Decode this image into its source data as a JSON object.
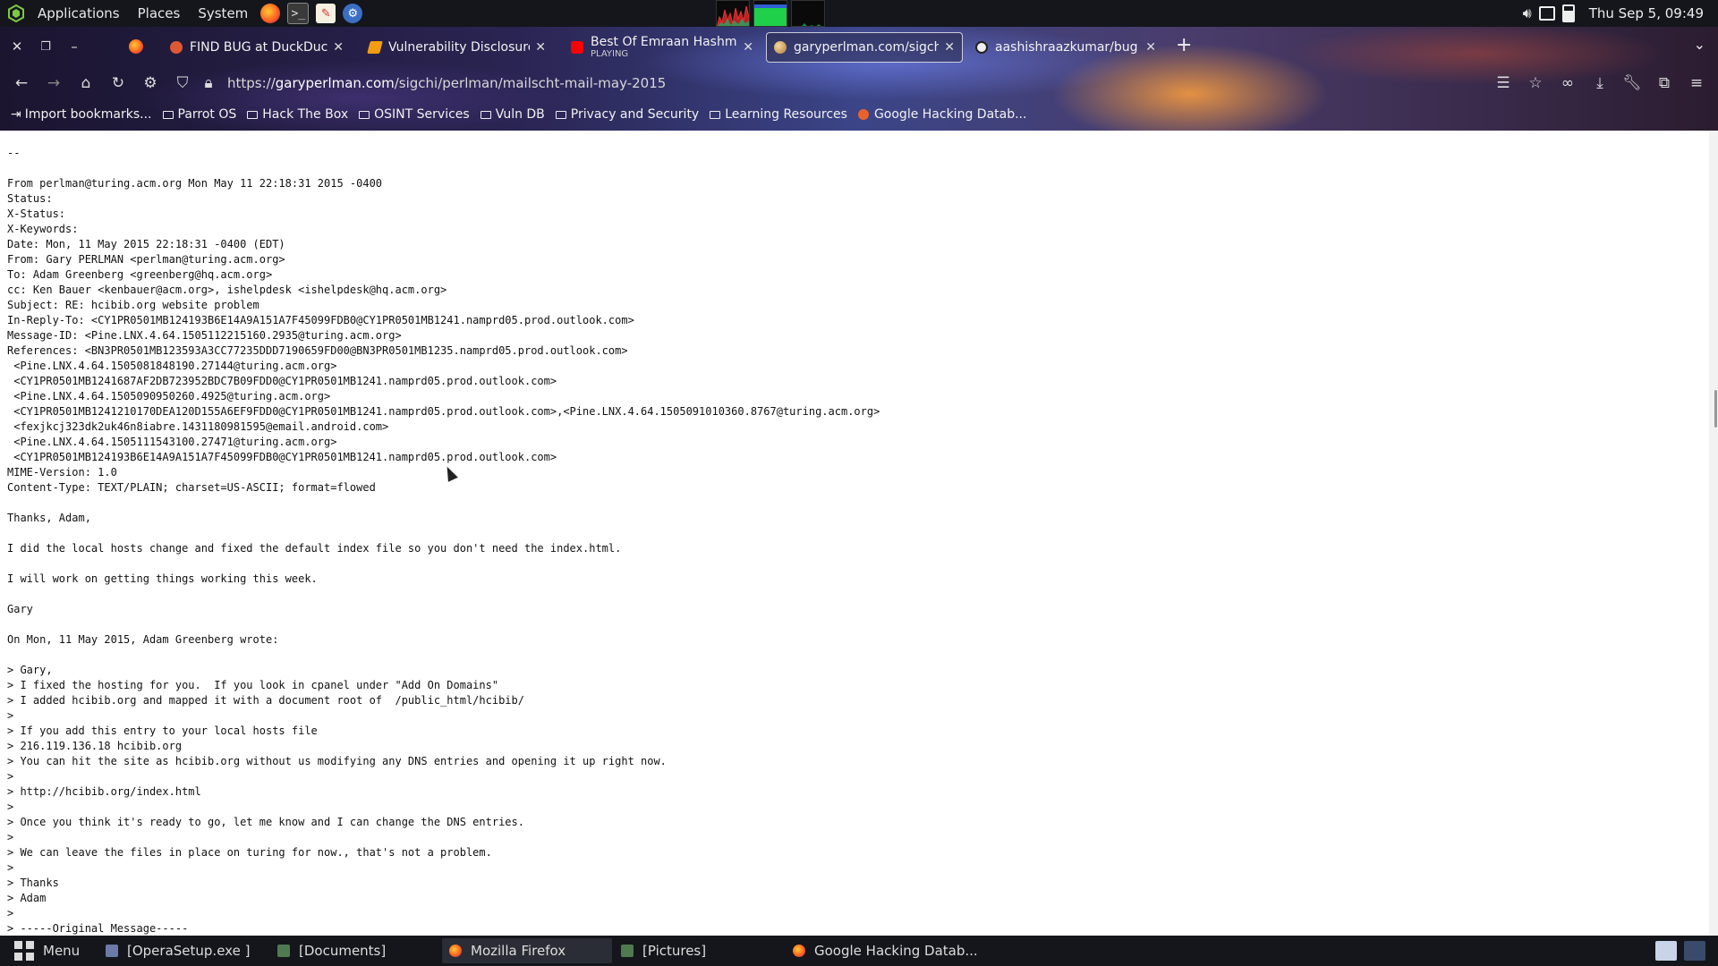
{
  "system_panel": {
    "menus": [
      "Applications",
      "Places",
      "System"
    ],
    "clock": "Thu Sep  5, 09:49"
  },
  "browser": {
    "tabs": [
      {
        "title": "FIND BUG at DuckDuckGo",
        "active": false
      },
      {
        "title": "Vulnerability Disclosure P",
        "active": false
      },
      {
        "title": "Best Of Emraan Hashmi",
        "subtitle": "PLAYING",
        "active": false
      },
      {
        "title": "garyperlman.com/sigchi/",
        "active": true
      },
      {
        "title": "aashishraazkumar/bug",
        "active": false
      }
    ],
    "new_tab_label": "+",
    "url_prefix": "https://",
    "url_host": "garyperlman.com",
    "url_path": "/sigchi/perlman/mailscht-mail-may-2015",
    "bookmarks": [
      "Import bookmarks...",
      "Parrot OS",
      "Hack The Box",
      "OSINT Services",
      "Vuln DB",
      "Privacy and Security",
      "Learning Resources",
      "Google Hacking Datab..."
    ]
  },
  "mail_lines": [
    "",
    "--",
    "",
    "From perlman@turing.acm.org Mon May 11 22:18:31 2015 -0400",
    "Status:",
    "X-Status:",
    "X-Keywords:",
    "Date: Mon, 11 May 2015 22:18:31 -0400 (EDT)",
    "From: Gary PERLMAN <perlman@turing.acm.org>",
    "To: Adam Greenberg <greenberg@hq.acm.org>",
    "cc: Ken Bauer <kenbauer@acm.org>, ishelpdesk <ishelpdesk@hq.acm.org>",
    "Subject: RE: hcibib.org website problem",
    "In-Reply-To: <CY1PR0501MB124193B6E14A9A151A7F45099FDB0@CY1PR0501MB1241.namprd05.prod.outlook.com>",
    "Message-ID: <Pine.LNX.4.64.1505112215160.2935@turing.acm.org>",
    "References: <BN3PR0501MB123593A3CC77235DDD7190659FD00@BN3PR0501MB1235.namprd05.prod.outlook.com>",
    " <Pine.LNX.4.64.1505081848190.27144@turing.acm.org>",
    " <CY1PR0501MB1241687AF2DB723952BDC7B09FDD0@CY1PR0501MB1241.namprd05.prod.outlook.com>",
    " <Pine.LNX.4.64.1505090950260.4925@turing.acm.org>",
    " <CY1PR0501MB1241210170DEA120D155A6EF9FDD0@CY1PR0501MB1241.namprd05.prod.outlook.com>,<Pine.LNX.4.64.1505091010360.8767@turing.acm.org>",
    " <fexjkcj323dk2uk46n8iabre.1431180981595@email.android.com>",
    " <Pine.LNX.4.64.1505111543100.27471@turing.acm.org>",
    " <CY1PR0501MB124193B6E14A9A151A7F45099FDB0@CY1PR0501MB1241.namprd05.prod.outlook.com>",
    "MIME-Version: 1.0",
    "Content-Type: TEXT/PLAIN; charset=US-ASCII; format=flowed",
    "",
    "Thanks, Adam,",
    "",
    "I did the local hosts change and fixed the default index file so you don't need the index.html.",
    "",
    "I will work on getting things working this week.",
    "",
    "Gary",
    "",
    "On Mon, 11 May 2015, Adam Greenberg wrote:",
    "",
    "> Gary,",
    "> I fixed the hosting for you.  If you look in cpanel under \"Add On Domains\"",
    "> I added hcibib.org and mapped it with a document root of  /public_html/hcibib/",
    ">",
    "> If you add this entry to your local hosts file",
    "> 216.119.136.18 hcibib.org",
    "> You can hit the site as hcibib.org without us modifying any DNS entries and opening it up right now.",
    ">",
    "> http://hcibib.org/index.html",
    ">",
    "> Once you think it's ready to go, let me know and I can change the DNS entries.",
    ">",
    "> We can leave the files in place on turing for now., that's not a problem.",
    ">",
    "> Thanks",
    "> Adam",
    ">",
    "> -----Original Message-----"
  ],
  "taskbar": {
    "menu_label": "Menu",
    "tasks": [
      {
        "label": "[OperaSetup.exe ]",
        "active": false
      },
      {
        "label": "[Documents]",
        "active": false
      },
      {
        "label": "Mozilla Firefox",
        "active": true
      },
      {
        "label": "[Pictures]",
        "active": false
      },
      {
        "label": "Google Hacking Datab...",
        "active": false
      }
    ]
  },
  "colors": {
    "panel_bg": "#14161c",
    "page_bg": "#ffffff",
    "text": "#111111"
  }
}
